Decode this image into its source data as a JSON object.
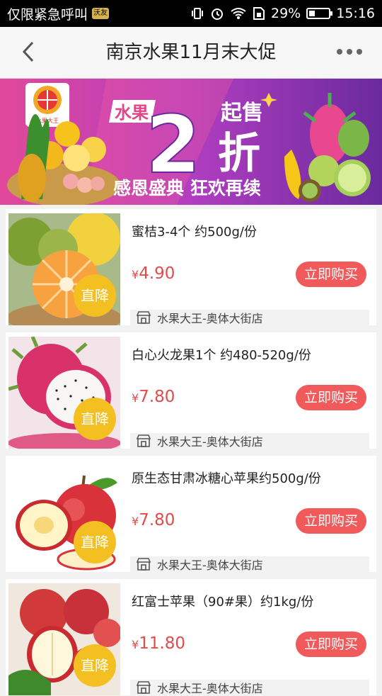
{
  "status_bar": {
    "left_text": "仅限紧急呼叫",
    "sim_badge": "沃友",
    "battery": "29%",
    "time": "15:16",
    "battery_level": 0.29
  },
  "nav": {
    "title": "南京水果11月末大促",
    "back_icon": "chevron-left-icon",
    "more_icon": "more-dots-icon"
  },
  "banner": {
    "logo_text": "水果大王",
    "tag": "水果",
    "big_number": "2",
    "suffix_top": "起售",
    "suffix_bottom": "折",
    "slogan": "感恩盛典 狂欢再续"
  },
  "products": [
    {
      "name": "蜜桔3-4个 约500g/份",
      "currency": "¥",
      "price": "4.90",
      "button": "立即购买",
      "badge": "直降",
      "store": "水果大王-奥体大街店",
      "fruit": "tangerine"
    },
    {
      "name": "白心火龙果1个 约480-520g/份",
      "currency": "¥",
      "price": "7.80",
      "button": "立即购买",
      "badge": "直降",
      "store": "水果大王-奥体大街店",
      "fruit": "dragonfruit"
    },
    {
      "name": "原生态甘肃冰糖心苹果约500g/份",
      "currency": "¥",
      "price": "7.80",
      "button": "立即购买",
      "badge": "直降",
      "store": "水果大王-奥体大街店",
      "fruit": "apple"
    },
    {
      "name": "红富士苹果（90#果）约1kg/份",
      "currency": "¥",
      "price": "11.80",
      "button": "立即购买",
      "badge": "直降",
      "store": "水果大王-奥体大街店",
      "fruit": "fuji-apple"
    }
  ]
}
